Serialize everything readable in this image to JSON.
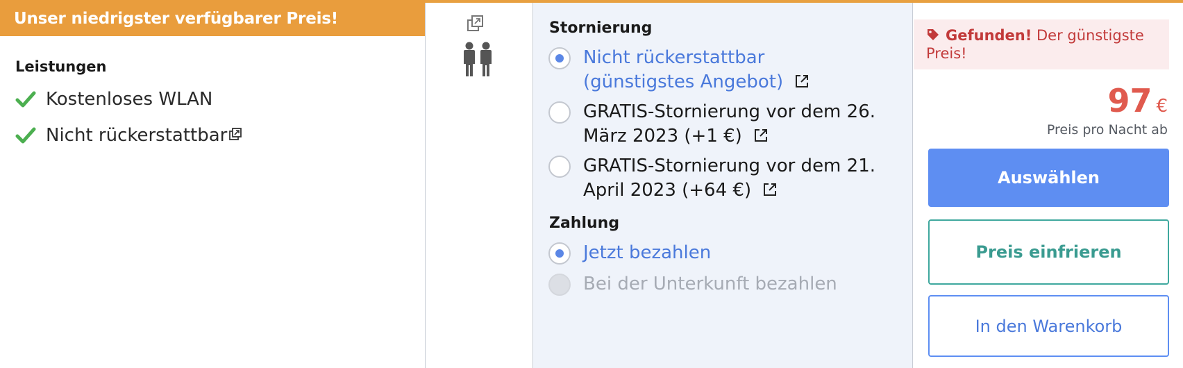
{
  "banner": {
    "text": "Unser niedrigster verfügbarer Preis!"
  },
  "features": {
    "title": "Leistungen",
    "items": [
      {
        "label": "Kostenloses WLAN"
      },
      {
        "label": "Nicht rückerstattbar"
      }
    ]
  },
  "cancellation": {
    "title": "Stornierung",
    "options": [
      {
        "line1": "Nicht rückerstattbar",
        "line2": "(günstigstes Angebot)",
        "selected": true
      },
      {
        "line1": "GRATIS-Stornierung vor dem 26.",
        "line2": "März 2023 (+1 €)",
        "selected": false
      },
      {
        "line1": "GRATIS-Stornierung vor dem 21.",
        "line2": "April 2023 (+64 €)",
        "selected": false
      }
    ]
  },
  "payment": {
    "title": "Zahlung",
    "options": [
      {
        "label": "Jetzt bezahlen",
        "selected": true
      },
      {
        "label": "Bei der Unterkunft bezahlen",
        "disabled": true
      }
    ]
  },
  "price_panel": {
    "found_bold": "Gefunden!",
    "found_rest_1": " Der günstigste",
    "found_rest_2": "Preis!",
    "price": "97",
    "currency": "€",
    "price_note": "Preis pro Nacht ab",
    "select_button": "Auswählen",
    "freeze_button": "Preis einfrieren",
    "cart_button": "In den Warenkorb"
  },
  "colors": {
    "banner": "#e99d3d",
    "accent_blue": "#5e8ef2",
    "price_red": "#e05a4e",
    "teal": "#3fa89e",
    "check_green": "#4caf50"
  },
  "icons": [
    "check-icon",
    "external-link-icon",
    "copy-icon",
    "people-icon",
    "tag-icon"
  ]
}
